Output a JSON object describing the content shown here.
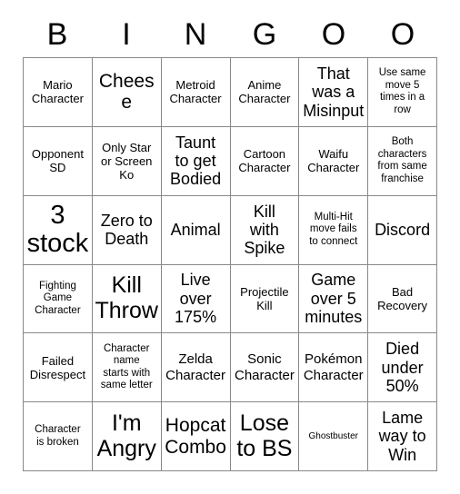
{
  "card": {
    "title": "Bingo Card",
    "columns": 6,
    "rows": 6,
    "background_color": "#ffffff",
    "text_color": "#000000",
    "border_color": "#888888",
    "header_letters": [
      "B",
      "I",
      "N",
      "G",
      "O",
      "O"
    ],
    "cells": [
      [
        {
          "text": "Mario\nCharacter",
          "size": "s"
        },
        {
          "text": "Cheese",
          "size": "xl"
        },
        {
          "text": "Metroid\nCharacter",
          "size": "s"
        },
        {
          "text": "Anime\nCharacter",
          "size": "s"
        },
        {
          "text": "That\nwas a\nMisinput",
          "size": "l"
        },
        {
          "text": "Use same\nmove 5\ntimes in a\nrow",
          "size": "xs"
        }
      ],
      [
        {
          "text": "Opponent\nSD",
          "size": "s"
        },
        {
          "text": "Only Star\nor Screen\nKo",
          "size": "s"
        },
        {
          "text": "Taunt\nto get\nBodied",
          "size": "l"
        },
        {
          "text": "Cartoon\nCharacter",
          "size": "s"
        },
        {
          "text": "Waifu\nCharacter",
          "size": "s"
        },
        {
          "text": "Both\ncharacters\nfrom same\nfranchise",
          "size": "xs"
        }
      ],
      [
        {
          "text": "3\nstock",
          "size": "xxxl"
        },
        {
          "text": "Zero to\nDeath",
          "size": "l"
        },
        {
          "text": "Animal",
          "size": "l"
        },
        {
          "text": "Kill\nwith\nSpike",
          "size": "l"
        },
        {
          "text": "Multi-Hit\nmove fails\nto connect",
          "size": "xs"
        },
        {
          "text": "Discord",
          "size": "l"
        }
      ],
      [
        {
          "text": "Fighting\nGame\nCharacter",
          "size": "xs"
        },
        {
          "text": "Kill\nThrow",
          "size": "xxl"
        },
        {
          "text": "Live\nover\n175%",
          "size": "l"
        },
        {
          "text": "Projectile\nKill",
          "size": "s"
        },
        {
          "text": "Game\nover 5\nminutes",
          "size": "l"
        },
        {
          "text": "Bad\nRecovery",
          "size": "s"
        }
      ],
      [
        {
          "text": "Failed\nDisrespect",
          "size": "s"
        },
        {
          "text": "Character\nname\nstarts with\nsame letter",
          "size": "xs"
        },
        {
          "text": "Zelda\nCharacter",
          "size": "m"
        },
        {
          "text": "Sonic\nCharacter",
          "size": "m"
        },
        {
          "text": "Pokémon\nCharacter",
          "size": "m"
        },
        {
          "text": "Died\nunder\n50%",
          "size": "l"
        }
      ],
      [
        {
          "text": "Character\nis broken",
          "size": "xs"
        },
        {
          "text": "I'm\nAngry",
          "size": "xxl"
        },
        {
          "text": "Hopcat\nCombo",
          "size": "xl"
        },
        {
          "text": "Lose\nto BS",
          "size": "xxl"
        },
        {
          "text": "Ghostbuster",
          "size": "xxs"
        },
        {
          "text": "Lame\nway to\nWin",
          "size": "l"
        }
      ]
    ]
  }
}
